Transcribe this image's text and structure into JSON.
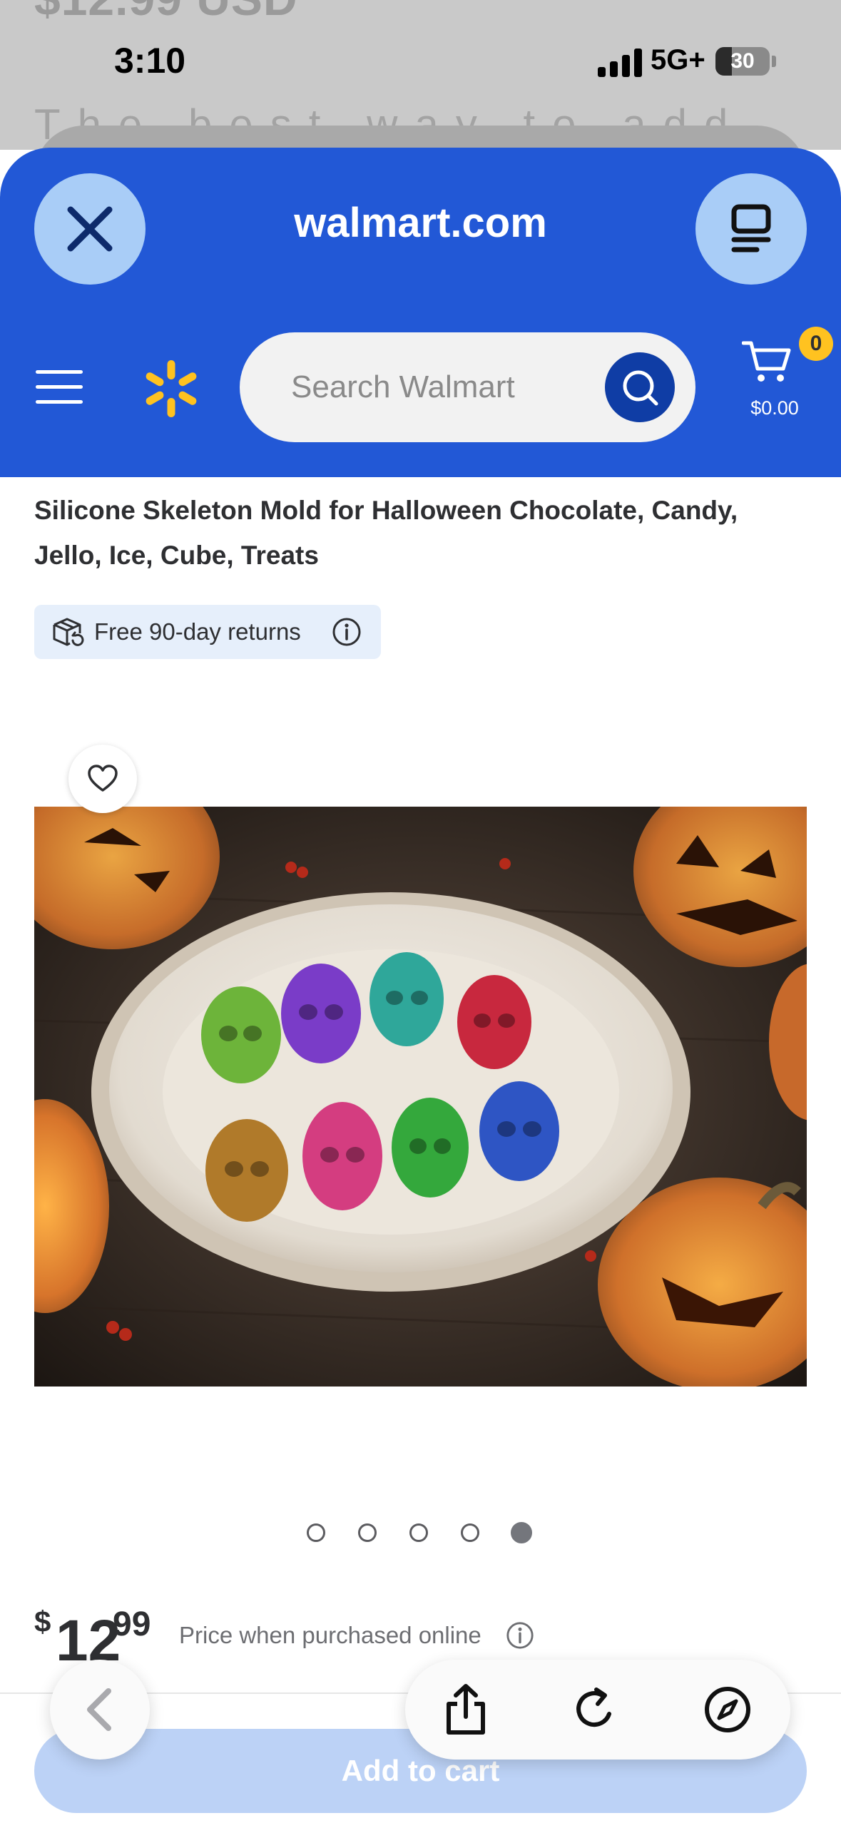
{
  "background_page": {
    "price_text": "$12.99 USD",
    "description_text": "The best way to add"
  },
  "status_bar": {
    "time": "3:10",
    "network": "5G+",
    "battery": "30",
    "battery_level_percent": 30
  },
  "browser_sheet": {
    "site_title": "walmart.com",
    "close_icon": "close-icon",
    "tabs_icon": "tabs-icon"
  },
  "header": {
    "search_placeholder": "Search Walmart",
    "cart_count": "0",
    "cart_total": "$0.00",
    "brand_color": "#2258d6",
    "spark_color": "#ffc220"
  },
  "product": {
    "title": "Silicone Skeleton Mold for Halloween Chocolate, Candy, Jello, Ice, Cube, Treats",
    "returns_label": "Free 90-day returns",
    "image_alt": "Colorful skull-shaped gummy treats on a white plate surrounded by jack-o'-lanterns",
    "carousel": {
      "count": 5,
      "active_index": 5
    },
    "price": {
      "symbol": "$",
      "whole": "12",
      "cents": "99"
    },
    "price_note": "Price when purchased online",
    "add_to_cart_label": "Add to cart"
  },
  "browser_toolbar": {
    "back_icon": "chevron-left-icon",
    "share_icon": "share-icon",
    "reload_icon": "reload-icon",
    "compass_icon": "compass-icon"
  }
}
